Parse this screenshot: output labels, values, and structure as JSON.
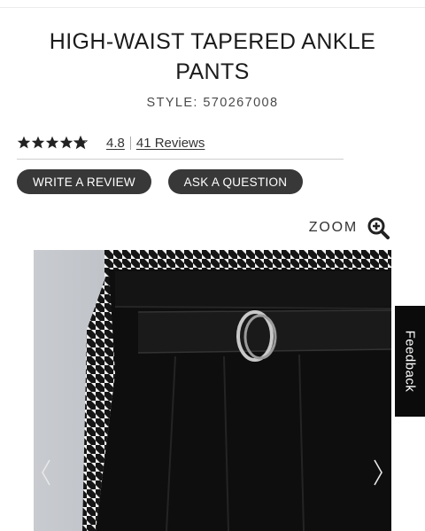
{
  "product": {
    "title_line1": "HIGH-WAIST TAPERED ANKLE",
    "title_line2": "PANTS",
    "style_label": "STYLE:",
    "style_number": "570267008"
  },
  "rating": {
    "value": "4.8",
    "stars": 4.8,
    "max_stars": 5,
    "reviews_text": "41 Reviews"
  },
  "actions": {
    "write_review_label": "WRITE A REVIEW",
    "ask_question_label": "ASK A QUESTION"
  },
  "gallery": {
    "zoom_label": "ZOOM",
    "zoom_icon": "zoom-in-icon",
    "prev_icon": "chevron-left-icon",
    "next_icon": "chevron-right-icon"
  },
  "feedback_tab": {
    "label": "Feedback"
  },
  "colors": {
    "button_bg": "#383838",
    "feedback_bg": "#0b0b0b",
    "text": "#1b1b1b"
  }
}
